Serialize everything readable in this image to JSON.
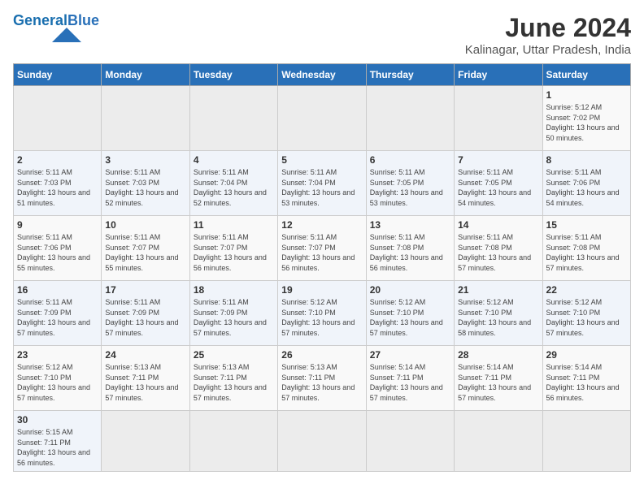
{
  "logo": {
    "general": "General",
    "blue": "Blue"
  },
  "title": "June 2024",
  "subtitle": "Kalinagar, Uttar Pradesh, India",
  "days_of_week": [
    "Sunday",
    "Monday",
    "Tuesday",
    "Wednesday",
    "Thursday",
    "Friday",
    "Saturday"
  ],
  "weeks": [
    [
      {
        "day": "",
        "empty": true
      },
      {
        "day": "",
        "empty": true
      },
      {
        "day": "",
        "empty": true
      },
      {
        "day": "",
        "empty": true
      },
      {
        "day": "",
        "empty": true
      },
      {
        "day": "",
        "empty": true
      },
      {
        "day": "1",
        "sunrise": "5:12 AM",
        "sunset": "7:02 PM",
        "daylight": "13 hours and 50 minutes."
      }
    ],
    [
      {
        "day": "2",
        "sunrise": "5:11 AM",
        "sunset": "7:03 PM",
        "daylight": "13 hours and 51 minutes."
      },
      {
        "day": "3",
        "sunrise": "5:11 AM",
        "sunset": "7:03 PM",
        "daylight": "13 hours and 52 minutes."
      },
      {
        "day": "4",
        "sunrise": "5:11 AM",
        "sunset": "7:04 PM",
        "daylight": "13 hours and 52 minutes."
      },
      {
        "day": "5",
        "sunrise": "5:11 AM",
        "sunset": "7:04 PM",
        "daylight": "13 hours and 53 minutes."
      },
      {
        "day": "6",
        "sunrise": "5:11 AM",
        "sunset": "7:05 PM",
        "daylight": "13 hours and 53 minutes."
      },
      {
        "day": "7",
        "sunrise": "5:11 AM",
        "sunset": "7:05 PM",
        "daylight": "13 hours and 54 minutes."
      },
      {
        "day": "8",
        "sunrise": "5:11 AM",
        "sunset": "7:06 PM",
        "daylight": "13 hours and 54 minutes."
      }
    ],
    [
      {
        "day": "9",
        "sunrise": "5:11 AM",
        "sunset": "7:06 PM",
        "daylight": "13 hours and 55 minutes."
      },
      {
        "day": "10",
        "sunrise": "5:11 AM",
        "sunset": "7:07 PM",
        "daylight": "13 hours and 55 minutes."
      },
      {
        "day": "11",
        "sunrise": "5:11 AM",
        "sunset": "7:07 PM",
        "daylight": "13 hours and 56 minutes."
      },
      {
        "day": "12",
        "sunrise": "5:11 AM",
        "sunset": "7:07 PM",
        "daylight": "13 hours and 56 minutes."
      },
      {
        "day": "13",
        "sunrise": "5:11 AM",
        "sunset": "7:08 PM",
        "daylight": "13 hours and 56 minutes."
      },
      {
        "day": "14",
        "sunrise": "5:11 AM",
        "sunset": "7:08 PM",
        "daylight": "13 hours and 57 minutes."
      },
      {
        "day": "15",
        "sunrise": "5:11 AM",
        "sunset": "7:08 PM",
        "daylight": "13 hours and 57 minutes."
      }
    ],
    [
      {
        "day": "16",
        "sunrise": "5:11 AM",
        "sunset": "7:09 PM",
        "daylight": "13 hours and 57 minutes."
      },
      {
        "day": "17",
        "sunrise": "5:11 AM",
        "sunset": "7:09 PM",
        "daylight": "13 hours and 57 minutes."
      },
      {
        "day": "18",
        "sunrise": "5:11 AM",
        "sunset": "7:09 PM",
        "daylight": "13 hours and 57 minutes."
      },
      {
        "day": "19",
        "sunrise": "5:12 AM",
        "sunset": "7:10 PM",
        "daylight": "13 hours and 57 minutes."
      },
      {
        "day": "20",
        "sunrise": "5:12 AM",
        "sunset": "7:10 PM",
        "daylight": "13 hours and 57 minutes."
      },
      {
        "day": "21",
        "sunrise": "5:12 AM",
        "sunset": "7:10 PM",
        "daylight": "13 hours and 58 minutes."
      },
      {
        "day": "22",
        "sunrise": "5:12 AM",
        "sunset": "7:10 PM",
        "daylight": "13 hours and 57 minutes."
      }
    ],
    [
      {
        "day": "23",
        "sunrise": "5:12 AM",
        "sunset": "7:10 PM",
        "daylight": "13 hours and 57 minutes."
      },
      {
        "day": "24",
        "sunrise": "5:13 AM",
        "sunset": "7:11 PM",
        "daylight": "13 hours and 57 minutes."
      },
      {
        "day": "25",
        "sunrise": "5:13 AM",
        "sunset": "7:11 PM",
        "daylight": "13 hours and 57 minutes."
      },
      {
        "day": "26",
        "sunrise": "5:13 AM",
        "sunset": "7:11 PM",
        "daylight": "13 hours and 57 minutes."
      },
      {
        "day": "27",
        "sunrise": "5:14 AM",
        "sunset": "7:11 PM",
        "daylight": "13 hours and 57 minutes."
      },
      {
        "day": "28",
        "sunrise": "5:14 AM",
        "sunset": "7:11 PM",
        "daylight": "13 hours and 57 minutes."
      },
      {
        "day": "29",
        "sunrise": "5:14 AM",
        "sunset": "7:11 PM",
        "daylight": "13 hours and 56 minutes."
      }
    ],
    [
      {
        "day": "30",
        "sunrise": "5:15 AM",
        "sunset": "7:11 PM",
        "daylight": "13 hours and 56 minutes."
      },
      {
        "day": "",
        "empty": true
      },
      {
        "day": "",
        "empty": true
      },
      {
        "day": "",
        "empty": true
      },
      {
        "day": "",
        "empty": true
      },
      {
        "day": "",
        "empty": true
      },
      {
        "day": "",
        "empty": true
      }
    ]
  ],
  "labels": {
    "sunrise": "Sunrise:",
    "sunset": "Sunset:",
    "daylight": "Daylight:"
  }
}
